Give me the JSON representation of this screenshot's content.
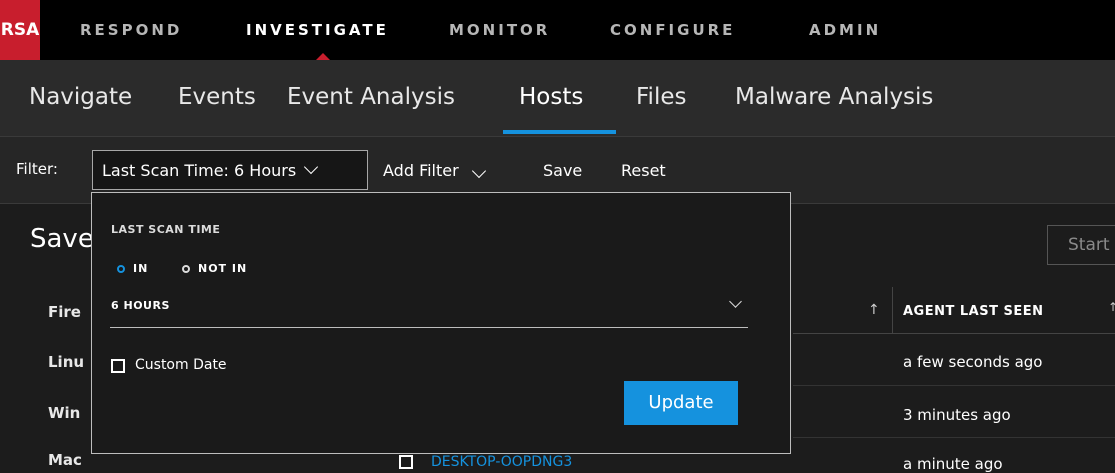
{
  "brand": {
    "logo_text": "RSA",
    "accent": "#c81e2d",
    "link_color": "#1592de"
  },
  "topnav": [
    {
      "label": "RESPOND"
    },
    {
      "label": "INVESTIGATE",
      "active": true
    },
    {
      "label": "MONITOR"
    },
    {
      "label": "CONFIGURE"
    },
    {
      "label": "ADMIN"
    }
  ],
  "subnav": [
    {
      "label": "Navigate"
    },
    {
      "label": "Events"
    },
    {
      "label": "Event Analysis"
    },
    {
      "label": "Hosts",
      "active": true
    },
    {
      "label": "Files"
    },
    {
      "label": "Malware Analysis"
    }
  ],
  "filterbar": {
    "label": "Filter:",
    "active_filter": "Last Scan Time: 6 Hours",
    "add_filter": "Add Filter",
    "save": "Save",
    "reset": "Reset"
  },
  "main": {
    "saved_title": "Save",
    "sidebar_items": [
      {
        "label": "Fire"
      },
      {
        "label": "Linu"
      },
      {
        "label": "Win"
      },
      {
        "label": "Mac"
      }
    ],
    "start_button": "Start",
    "table": {
      "column_header": "AGENT LAST SEEN",
      "rows": [
        {
          "agent_last_seen": "a few seconds ago"
        },
        {
          "agent_last_seen": "3 minutes ago"
        },
        {
          "host": "DESKTOP-OOPDNG3",
          "agent_last_seen": "a minute ago"
        }
      ]
    }
  },
  "panel": {
    "title": "LAST SCAN TIME",
    "radio_in": "IN",
    "radio_not_in": "NOT IN",
    "selected_radio": "IN",
    "selected_value": "6 HOURS",
    "custom_date_label": "Custom Date",
    "custom_date_checked": false,
    "update_button": "Update"
  }
}
